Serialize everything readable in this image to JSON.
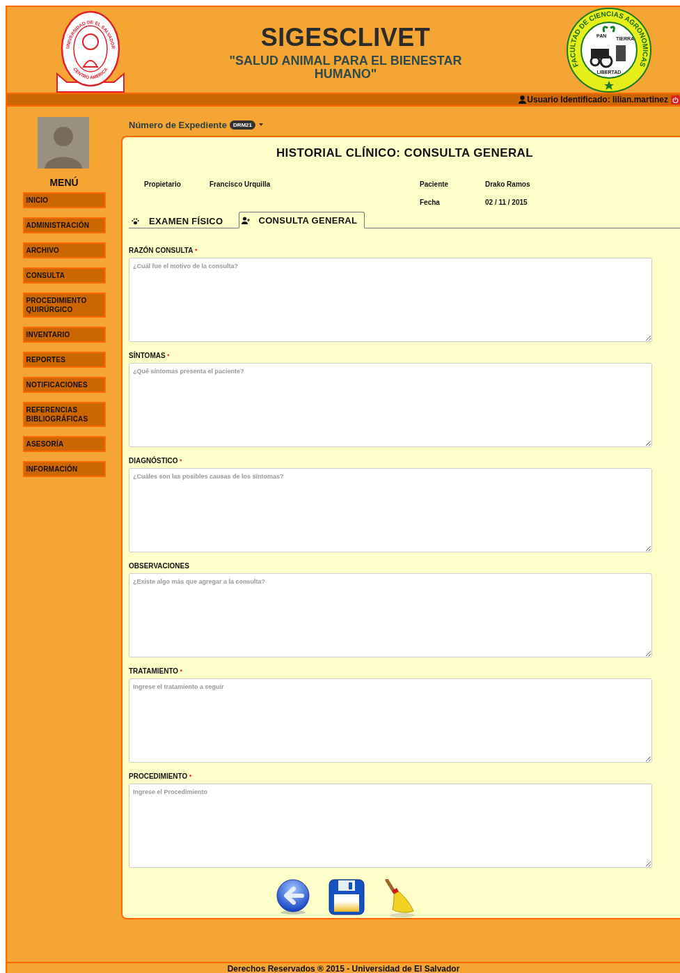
{
  "header": {
    "title": "SIGESCLIVET",
    "subtitle": "\"SALUD ANIMAL PARA EL BIENESTAR HUMANO\"",
    "left_logo": {
      "ring_text": "UNIVERSIDAD DE EL SALVADOR",
      "bottom_text": "CENTRO AMERICA"
    },
    "right_logo": {
      "ring_text": "FACULTAD DE CIENCIAS AGRONOMICAS",
      "words": [
        "PAN",
        "TIERRA",
        "LIBERTAD"
      ]
    }
  },
  "user_bar": {
    "label": "Usuario Identificado: lilian.martinez"
  },
  "sidebar": {
    "menu_title": "MENÚ",
    "items": [
      {
        "label": "INICIO"
      },
      {
        "label": "ADMINISTRACIÓN"
      },
      {
        "label": "ARCHIVO"
      },
      {
        "label": "CONSULTA"
      },
      {
        "label": "PROCEDIMIENTO QUIRÚRGICO"
      },
      {
        "label": "INVENTARIO"
      },
      {
        "label": "REPORTES"
      },
      {
        "label": "NOTIFICACIONES"
      },
      {
        "label": "REFERENCIAS BIBLIOGRÁFICAS"
      },
      {
        "label": "ASESORÍA"
      },
      {
        "label": "INFORMACIÓN"
      }
    ]
  },
  "record": {
    "label": "Número de Expediente",
    "badge": "DRM21"
  },
  "panel": {
    "title": "HISTORIAL CLÍNICO: CONSULTA GENERAL",
    "info": [
      {
        "label": "Propietario",
        "value": "Francisco Urquilla"
      },
      {
        "label": "Paciente",
        "value": "Drako Ramos"
      },
      {
        "label": "Fecha",
        "value": "02 / 11 / 2015"
      }
    ],
    "tabs": [
      {
        "label": "EXAMEN FÍSICO",
        "selected": false
      },
      {
        "label": "CONSULTA GENERAL",
        "selected": true
      }
    ],
    "fields": [
      {
        "label": "RAZÓN CONSULTA",
        "required": true,
        "placeholder": "¿Cuál fue el motivo de la consulta?"
      },
      {
        "label": "SÍNTOMAS",
        "required": true,
        "placeholder": "¿Qué síntomas presenta el paciente?"
      },
      {
        "label": "DIAGNÓSTICO",
        "required": true,
        "placeholder": "¿Cuáles son las posibles causas de los síntomas?"
      },
      {
        "label": "OBSERVACIONES",
        "required": false,
        "placeholder": "¿Existe algo más que agregar a la consulta?"
      },
      {
        "label": "TRATAMIENTO",
        "required": true,
        "placeholder": "Ingrese el tratamiento a seguir"
      },
      {
        "label": "PROCEDIMIENTO",
        "required": true,
        "placeholder": "Ingrese el Procedimiento"
      }
    ],
    "required_mark": "*",
    "actions": [
      {
        "kind": "back"
      },
      {
        "kind": "save"
      },
      {
        "kind": "clear"
      }
    ]
  },
  "footer": {
    "text": "Derechos Reservados ® 2015 - Universidad de El Salvador"
  }
}
